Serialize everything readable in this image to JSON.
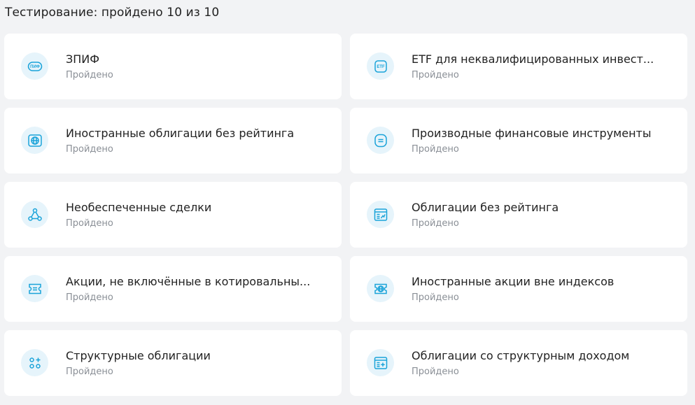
{
  "header": {
    "title": "Тестирование: пройдено 10 из 10"
  },
  "accent_color": "#1aa3d9",
  "icon_bg_color": "#e6f4fb",
  "cards": [
    {
      "title": "ЗПИФ",
      "status": "Пройдено",
      "icon": "pif-icon"
    },
    {
      "title": "ETF для неквалифицированных инвест...",
      "status": "Пройдено",
      "icon": "etf-icon"
    },
    {
      "title": "Иностранные облигации без рейтинга",
      "status": "Пройдено",
      "icon": "globe-icon"
    },
    {
      "title": "Производные финансовые инструменты",
      "status": "Пройдено",
      "icon": "derivatives-icon"
    },
    {
      "title": "Необеспеченные сделки",
      "status": "Пройдено",
      "icon": "network-icon"
    },
    {
      "title": "Облигации без рейтинга",
      "status": "Пройдено",
      "icon": "bond-chart-icon"
    },
    {
      "title": "Акции, не включённые в котировальны...",
      "status": "Пройдено",
      "icon": "ticket-icon"
    },
    {
      "title": "Иностранные акции вне индексов",
      "status": "Пройдено",
      "icon": "globe-certificate-icon"
    },
    {
      "title": "Структурные облигации",
      "status": "Пройдено",
      "icon": "structure-icon"
    },
    {
      "title": "Облигации со структурным доходом",
      "status": "Пройдено",
      "icon": "bond-plus-icon"
    }
  ]
}
